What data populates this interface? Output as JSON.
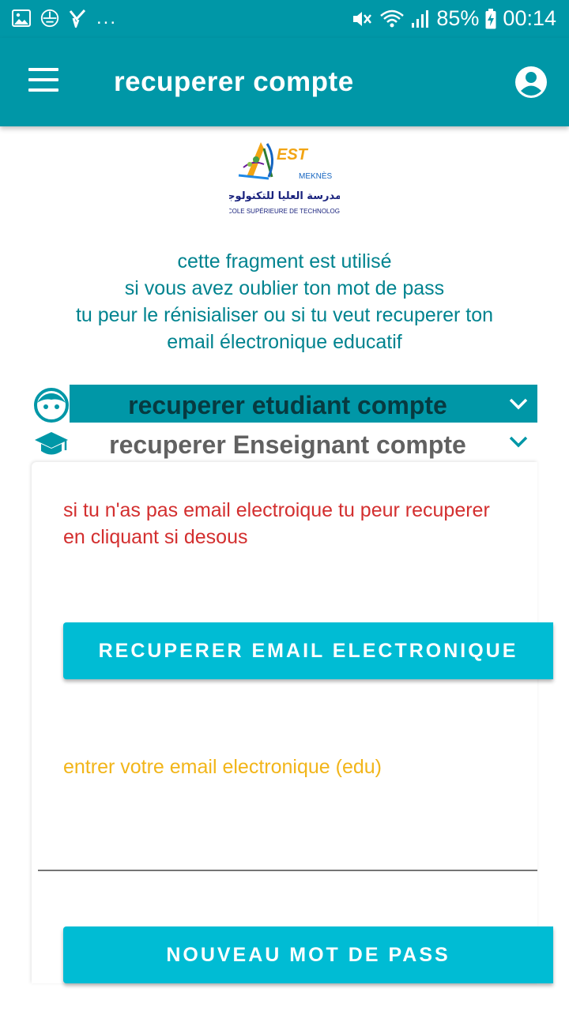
{
  "status_bar": {
    "icons_left": [
      "image-icon",
      "app-icon",
      "check-icon"
    ],
    "more": "...",
    "battery_percent": "85%",
    "time": "00:14"
  },
  "app_bar": {
    "title": "recuperer compte",
    "color": "#0097a7"
  },
  "logo": {
    "latin_text": "EST",
    "city": "MEKNÈS",
    "arabic_text": "المدرسة العليا للتكنولوجيا",
    "french_text": "ÉCOLE SUPÉRIEURE DE TECHNOLOGIE"
  },
  "intro": {
    "lines": [
      "cette fragment est utilisé",
      "si vous avez oublier ton mot de pass",
      "tu peur le rénisialiser ou si tu veut recuperer ton",
      "email électronique educatif"
    ]
  },
  "sections": {
    "student": {
      "label": "recuperer etudiant  compte",
      "icon": "student-face-icon"
    },
    "teacher": {
      "label": "recuperer Enseignant compte",
      "icon": "graduation-cap-icon"
    }
  },
  "form": {
    "help_text_1": "si tu n'as pas email electroique tu peur recuperer",
    "help_text_2": "en cliquant si desous",
    "recover_email_button": "RECUPERER EMAIL ELECTRONIQUE",
    "email_hint": "entrer votre email electronique (edu)",
    "email_value": "",
    "new_password_button": "NOUVEAU MOT DE PASS"
  },
  "colors": {
    "primary": "#0097a7",
    "button": "#00bcd4",
    "error_text": "#d32f2f",
    "hint_text": "#f2b519"
  }
}
